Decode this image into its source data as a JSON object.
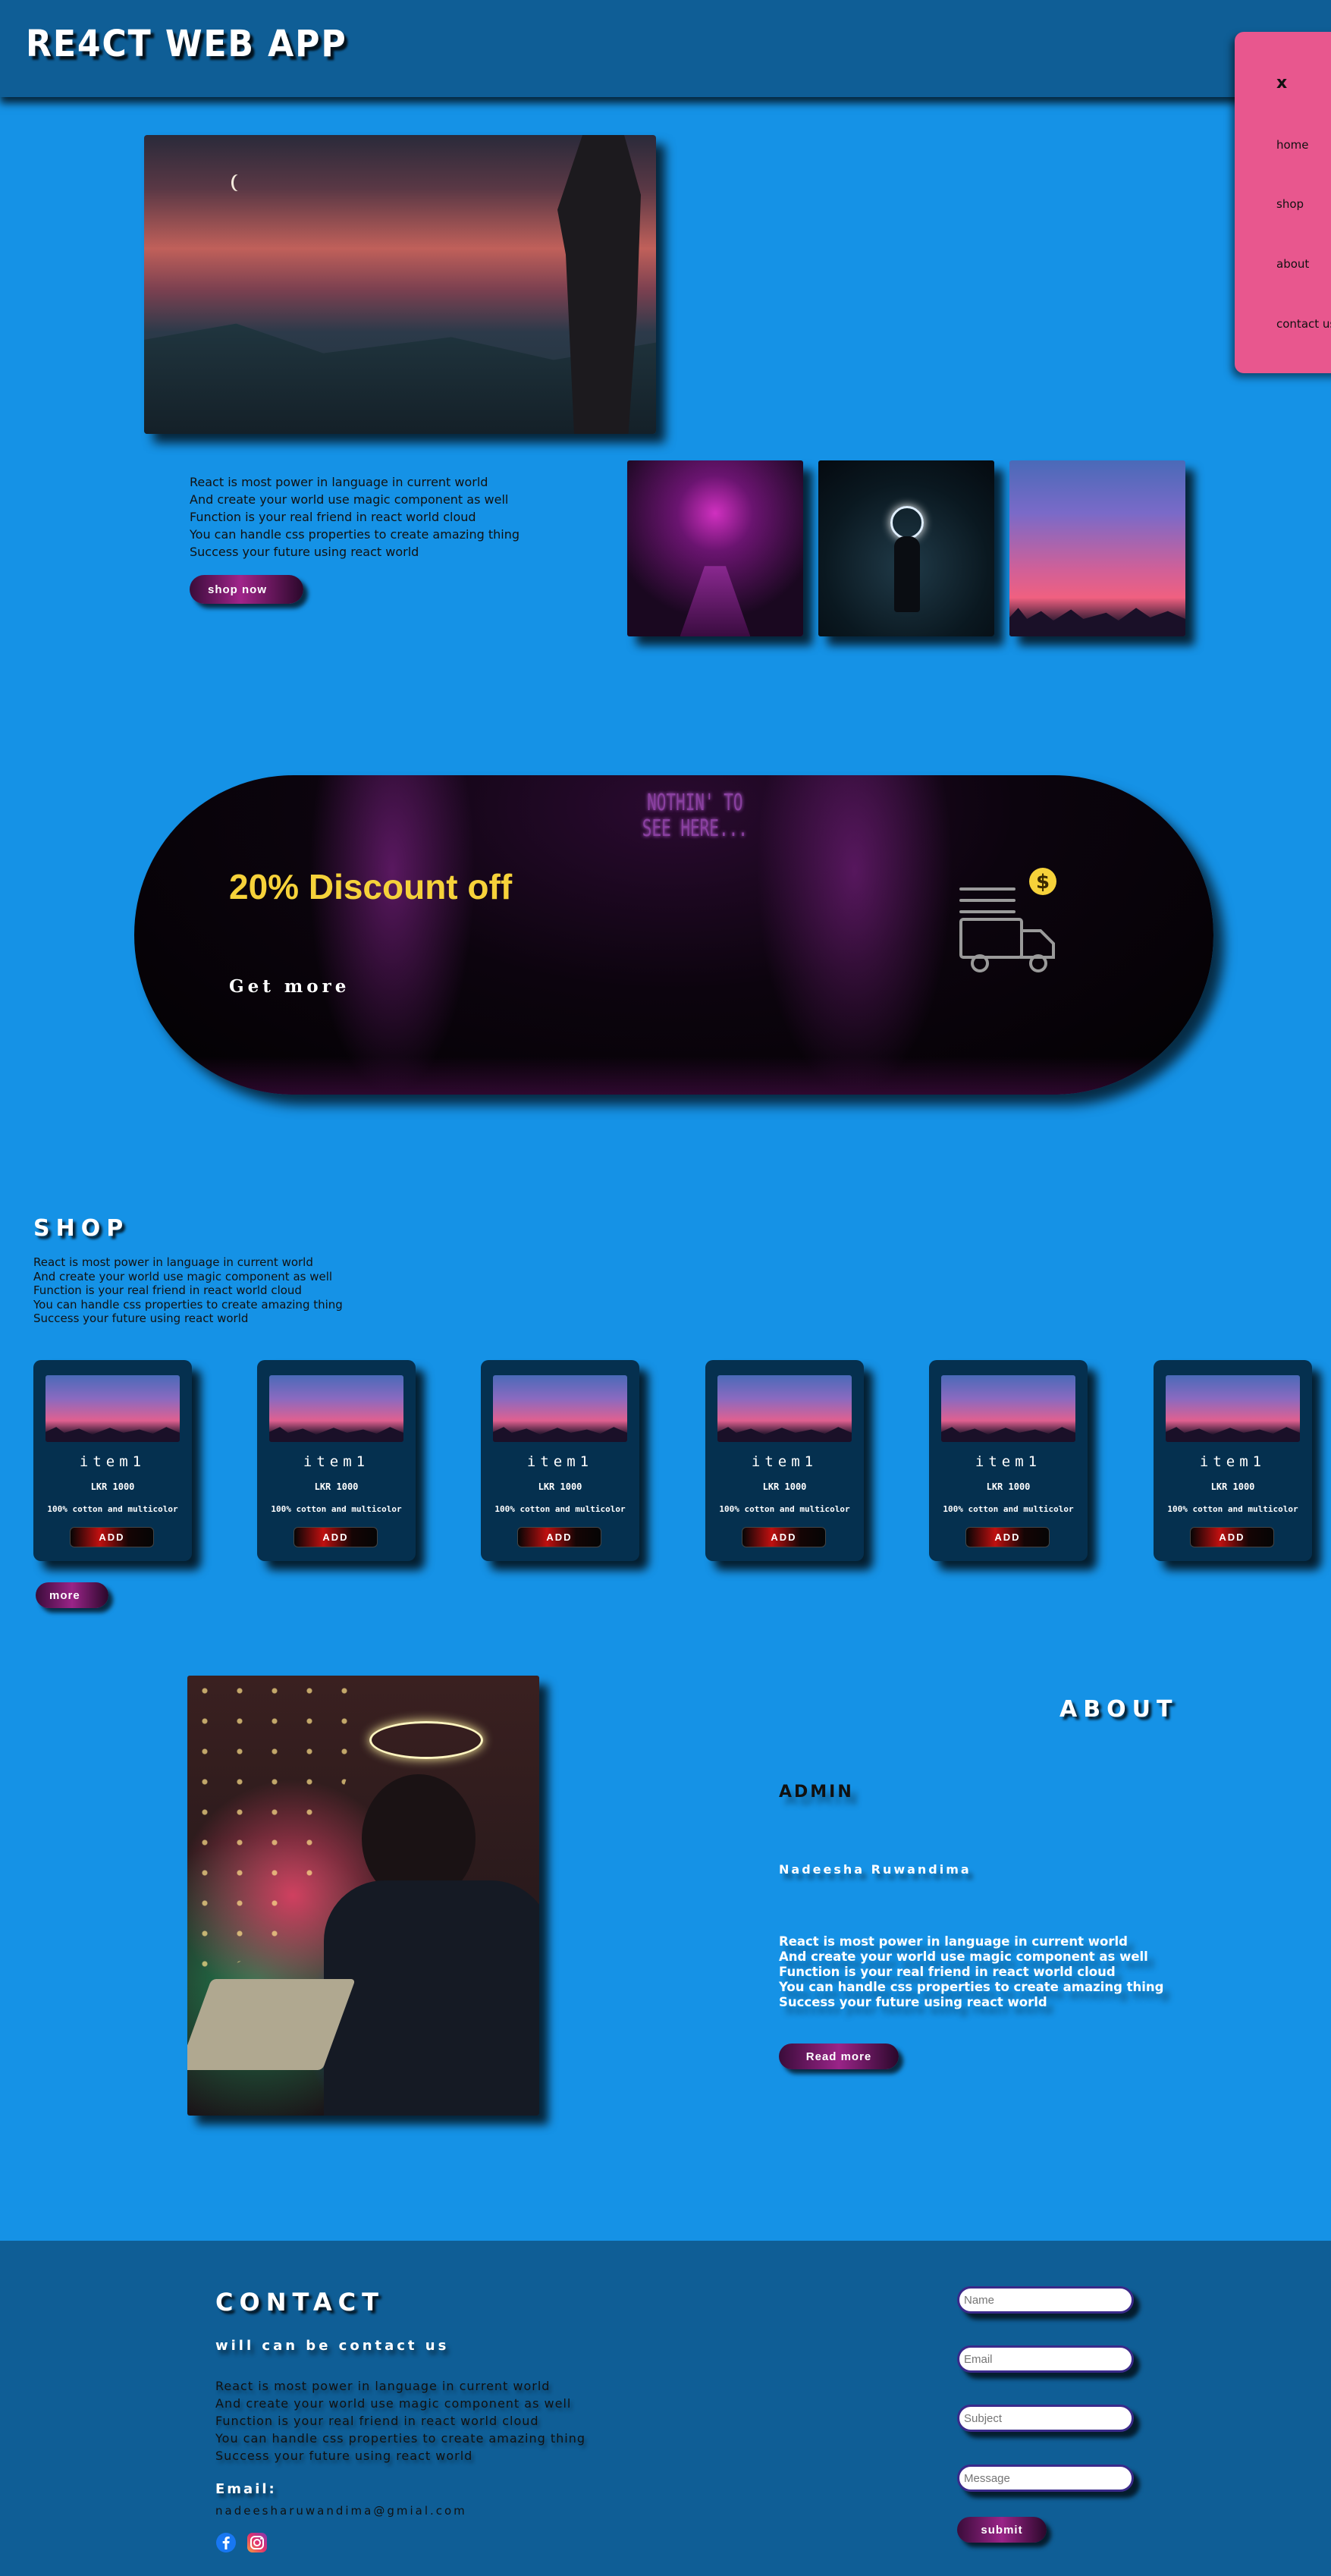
{
  "header": {
    "logo": "RE4CT WEB APP"
  },
  "menu": {
    "close": "x",
    "items": [
      {
        "label": "home"
      },
      {
        "label": "shop"
      },
      {
        "label": "about"
      },
      {
        "label": "contact us"
      }
    ]
  },
  "hero": {
    "lines": [
      "React is most power in language in current world",
      "And create your world use magic component as well",
      "Function is your real friend in react world cloud",
      "You can handle css properties to create amazing thing",
      "Success your future using react world"
    ],
    "button": "shop now"
  },
  "banner": {
    "neon": [
      "NOTHIN' TO",
      "SEE HERE..."
    ],
    "discount": "20% Discount off",
    "cta": "Get more",
    "icon": "delivery-truck-dollar-icon",
    "colors": {
      "discount": "#f6d23a"
    }
  },
  "shop": {
    "title": "SHOP",
    "lines": [
      "React is most power in language in current world",
      "And create your world use magic component as well",
      "Function is your real friend in react world cloud",
      "You can handle css properties to create amazing thing",
      "Success your future using react world"
    ],
    "cards": [
      {
        "title": "item1",
        "price": "LKR 1000",
        "desc": "100% cotton and multicolor",
        "button": "ADD"
      },
      {
        "title": "item1",
        "price": "LKR 1000",
        "desc": "100% cotton and multicolor",
        "button": "ADD"
      },
      {
        "title": "item1",
        "price": "LKR 1000",
        "desc": "100% cotton and multicolor",
        "button": "ADD"
      },
      {
        "title": "item1",
        "price": "LKR 1000",
        "desc": "100% cotton and multicolor",
        "button": "ADD"
      },
      {
        "title": "item1",
        "price": "LKR 1000",
        "desc": "100% cotton and multicolor",
        "button": "ADD"
      },
      {
        "title": "item1",
        "price": "LKR 1000",
        "desc": "100% cotton and multicolor",
        "button": "ADD"
      }
    ],
    "more": "more"
  },
  "about": {
    "title": "ABOUT",
    "role": "ADMIN",
    "name": "Nadeesha Ruwandima",
    "lines": [
      "React is most power in language in current world",
      "And create your world use magic component as well",
      "Function is your real friend in react world cloud",
      "You can handle css properties to create amazing thing",
      "Success your future using react world"
    ],
    "button": "Read more"
  },
  "contact": {
    "title": "CONTACT",
    "subtitle": "will can be contact us",
    "lines": [
      "React is most power in language in current world",
      "And create your world use magic component as well",
      "Function is your real friend in react world cloud",
      "You can handle css properties to create amazing thing",
      "Success your future using react world"
    ],
    "email_label": "Email:",
    "email": "nadeesharuwandima@gmial.com",
    "social": [
      "facebook-icon",
      "instagram-icon"
    ],
    "form": {
      "name_placeholder": "Name",
      "email_placeholder": "Email",
      "subject_placeholder": "Subject",
      "message_placeholder": "Message",
      "submit": "submit"
    }
  }
}
